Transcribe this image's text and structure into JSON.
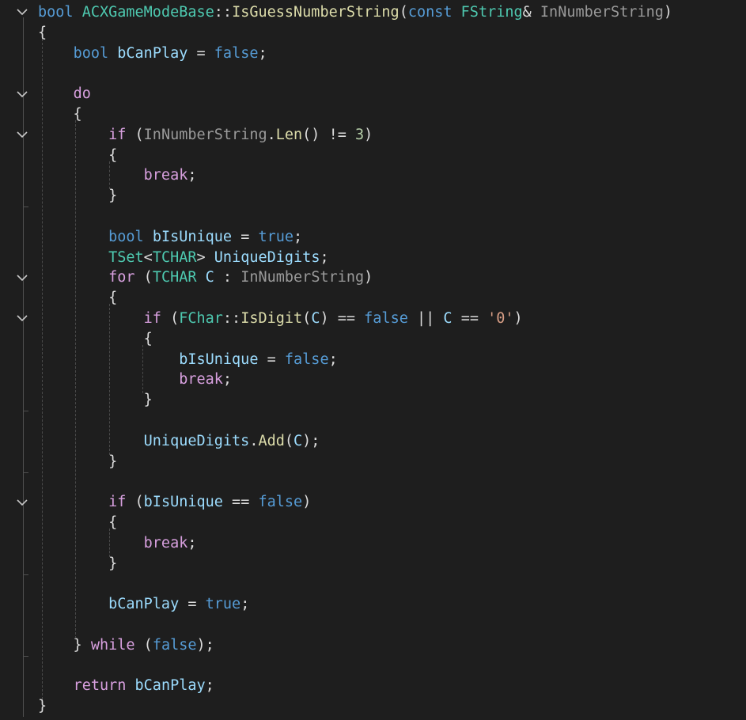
{
  "editor": {
    "language": "cpp",
    "colors": {
      "background": "#1e1e1e",
      "keyword": "#569cd6",
      "control": "#d8a0df",
      "type": "#4ec9b0",
      "function": "#dcdcaa",
      "variable": "#9cdcfe",
      "number": "#b5cea8",
      "string": "#d69d85",
      "parameter": "#9a9a9a",
      "text": "#dcdcdc"
    },
    "fold_icon": "chevron-down-icon",
    "lines": [
      [
        [
          "kw",
          "bool"
        ],
        [
          "pun",
          " "
        ],
        [
          "type",
          "ACXGameModeBase"
        ],
        [
          "pun",
          "::"
        ],
        [
          "fn",
          "IsGuessNumberString"
        ],
        [
          "pun",
          "("
        ],
        [
          "kw",
          "const"
        ],
        [
          "pun",
          " "
        ],
        [
          "type",
          "FString"
        ],
        [
          "pun",
          "& "
        ],
        [
          "par",
          "InNumberString"
        ],
        [
          "pun",
          ")"
        ]
      ],
      [
        [
          "pun",
          "{"
        ]
      ],
      [
        [
          "pun",
          "    "
        ],
        [
          "kw",
          "bool"
        ],
        [
          "pun",
          " "
        ],
        [
          "var",
          "bCanPlay"
        ],
        [
          "pun",
          " = "
        ],
        [
          "kw",
          "false"
        ],
        [
          "pun",
          ";"
        ]
      ],
      [],
      [
        [
          "pun",
          "    "
        ],
        [
          "ctl",
          "do"
        ]
      ],
      [
        [
          "pun",
          "    {"
        ]
      ],
      [
        [
          "pun",
          "        "
        ],
        [
          "ctl",
          "if"
        ],
        [
          "pun",
          " ("
        ],
        [
          "par",
          "InNumberString"
        ],
        [
          "pun",
          "."
        ],
        [
          "fn",
          "Len"
        ],
        [
          "pun",
          "() != "
        ],
        [
          "num",
          "3"
        ],
        [
          "pun",
          ")"
        ]
      ],
      [
        [
          "pun",
          "        {"
        ]
      ],
      [
        [
          "pun",
          "            "
        ],
        [
          "ctl",
          "break"
        ],
        [
          "pun",
          ";"
        ]
      ],
      [
        [
          "pun",
          "        }"
        ]
      ],
      [],
      [
        [
          "pun",
          "        "
        ],
        [
          "kw",
          "bool"
        ],
        [
          "pun",
          " "
        ],
        [
          "var",
          "bIsUnique"
        ],
        [
          "pun",
          " = "
        ],
        [
          "kw",
          "true"
        ],
        [
          "pun",
          ";"
        ]
      ],
      [
        [
          "pun",
          "        "
        ],
        [
          "type",
          "TSet"
        ],
        [
          "pun",
          "<"
        ],
        [
          "type",
          "TCHAR"
        ],
        [
          "pun",
          "> "
        ],
        [
          "var",
          "UniqueDigits"
        ],
        [
          "pun",
          ";"
        ]
      ],
      [
        [
          "pun",
          "        "
        ],
        [
          "ctl",
          "for"
        ],
        [
          "pun",
          " ("
        ],
        [
          "type",
          "TCHAR"
        ],
        [
          "pun",
          " "
        ],
        [
          "var",
          "C"
        ],
        [
          "pun",
          " : "
        ],
        [
          "par",
          "InNumberString"
        ],
        [
          "pun",
          ")"
        ]
      ],
      [
        [
          "pun",
          "        {"
        ]
      ],
      [
        [
          "pun",
          "            "
        ],
        [
          "ctl",
          "if"
        ],
        [
          "pun",
          " ("
        ],
        [
          "type",
          "FChar"
        ],
        [
          "pun",
          "::"
        ],
        [
          "fn",
          "IsDigit"
        ],
        [
          "pun",
          "("
        ],
        [
          "var",
          "C"
        ],
        [
          "pun",
          ") == "
        ],
        [
          "kw",
          "false"
        ],
        [
          "pun",
          " || "
        ],
        [
          "var",
          "C"
        ],
        [
          "pun",
          " == "
        ],
        [
          "str",
          "'0'"
        ],
        [
          "pun",
          ")"
        ]
      ],
      [
        [
          "pun",
          "            {"
        ]
      ],
      [
        [
          "pun",
          "                "
        ],
        [
          "var",
          "bIsUnique"
        ],
        [
          "pun",
          " = "
        ],
        [
          "kw",
          "false"
        ],
        [
          "pun",
          ";"
        ]
      ],
      [
        [
          "pun",
          "                "
        ],
        [
          "ctl",
          "break"
        ],
        [
          "pun",
          ";"
        ]
      ],
      [
        [
          "pun",
          "            }"
        ]
      ],
      [],
      [
        [
          "pun",
          "            "
        ],
        [
          "var",
          "UniqueDigits"
        ],
        [
          "pun",
          "."
        ],
        [
          "fn",
          "Add"
        ],
        [
          "pun",
          "("
        ],
        [
          "var",
          "C"
        ],
        [
          "pun",
          ");"
        ]
      ],
      [
        [
          "pun",
          "        }"
        ]
      ],
      [],
      [
        [
          "pun",
          "        "
        ],
        [
          "ctl",
          "if"
        ],
        [
          "pun",
          " ("
        ],
        [
          "var",
          "bIsUnique"
        ],
        [
          "pun",
          " == "
        ],
        [
          "kw",
          "false"
        ],
        [
          "pun",
          ")"
        ]
      ],
      [
        [
          "pun",
          "        {"
        ]
      ],
      [
        [
          "pun",
          "            "
        ],
        [
          "ctl",
          "break"
        ],
        [
          "pun",
          ";"
        ]
      ],
      [
        [
          "pun",
          "        }"
        ]
      ],
      [],
      [
        [
          "pun",
          "        "
        ],
        [
          "var",
          "bCanPlay"
        ],
        [
          "pun",
          " = "
        ],
        [
          "kw",
          "true"
        ],
        [
          "pun",
          ";"
        ]
      ],
      [],
      [
        [
          "pun",
          "    } "
        ],
        [
          "ctl",
          "while"
        ],
        [
          "pun",
          " ("
        ],
        [
          "kw",
          "false"
        ],
        [
          "pun",
          ");"
        ]
      ],
      [],
      [
        [
          "pun",
          "    "
        ],
        [
          "ctl",
          "return"
        ],
        [
          "pun",
          " "
        ],
        [
          "var",
          "bCanPlay"
        ],
        [
          "pun",
          ";"
        ]
      ],
      [
        [
          "pun",
          "}"
        ]
      ]
    ]
  }
}
